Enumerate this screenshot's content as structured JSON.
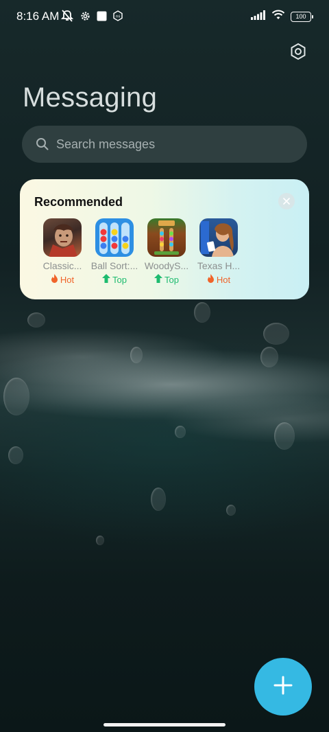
{
  "status_bar": {
    "time": "8:16 AM",
    "battery": "100",
    "icons": [
      "bell-off-icon",
      "gear-icon",
      "square-icon",
      "mi-icon",
      "signal-icon",
      "wifi-icon",
      "battery-icon"
    ]
  },
  "header": {
    "title": "Messaging",
    "settings_icon": "settings-hexagon-icon"
  },
  "search": {
    "placeholder": "Search messages"
  },
  "recommended": {
    "title": "Recommended",
    "close_icon": "close-icon",
    "apps": [
      {
        "name": "Classic...",
        "badge": "Hot",
        "badge_type": "hot"
      },
      {
        "name": "Ball Sort:...",
        "badge": "Top",
        "badge_type": "top"
      },
      {
        "name": "WoodyS...",
        "badge": "Top",
        "badge_type": "top"
      },
      {
        "name": "Texas H...",
        "badge": "Hot",
        "badge_type": "hot"
      }
    ]
  },
  "fab": {
    "icon": "plus-icon"
  },
  "colors": {
    "accent": "#35b9e3",
    "hot": "#f0642a",
    "top": "#1dbb6f"
  }
}
